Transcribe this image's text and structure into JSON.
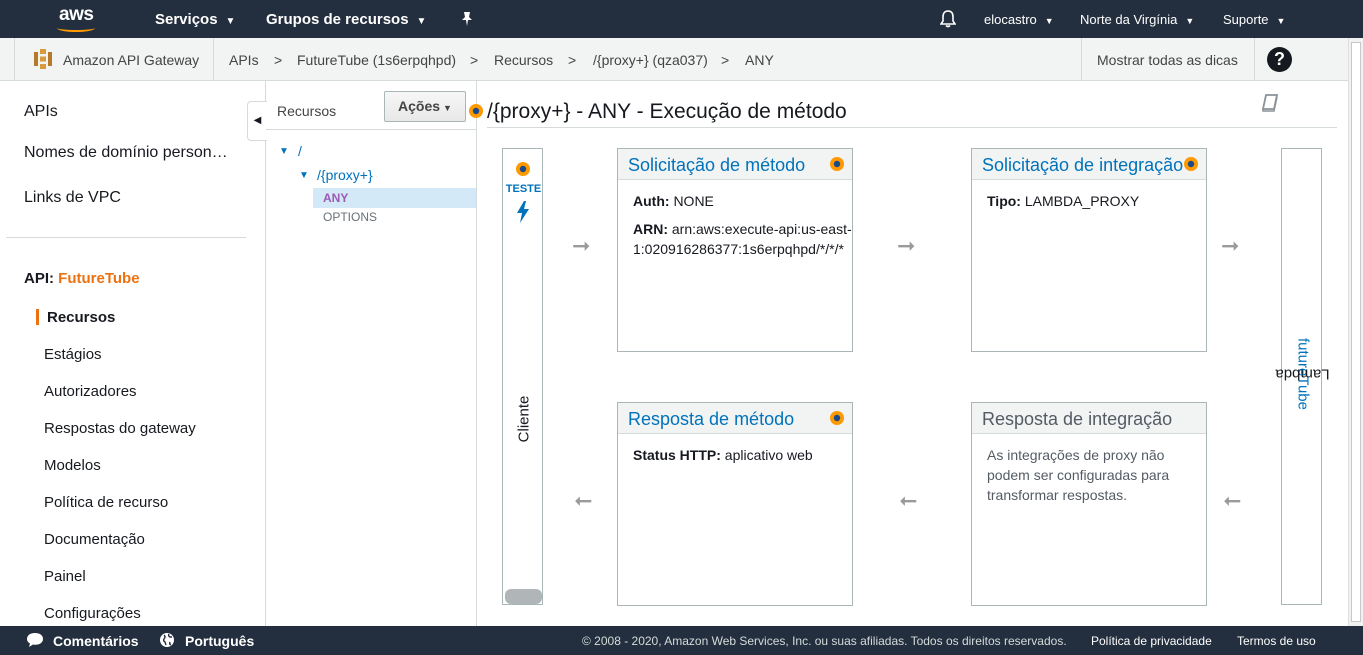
{
  "topnav": {
    "logo": "aws",
    "services": "Serviços",
    "resource_groups": "Grupos de recursos",
    "user": "elocastro",
    "region": "Norte da Virgínia",
    "support": "Suporte",
    "icons": [
      "pin-icon",
      "bell-icon",
      "chevron-down-icon"
    ]
  },
  "breadcrumb": {
    "service": "Amazon API Gateway",
    "items": [
      "APIs",
      "FutureTube (1s6erpqhpd)",
      "Recursos",
      "/{proxy+} (qza037)",
      "ANY"
    ],
    "separator": ">",
    "tips": "Mostrar todas as dicas",
    "help": "?"
  },
  "leftnav": {
    "top_items": [
      "APIs",
      "Nomes de domínio person…",
      "Links de VPC"
    ],
    "api_prefix": "API:",
    "api_name": "FutureTube",
    "sub_items": [
      "Recursos",
      "Estágios",
      "Autorizadores",
      "Respostas do gateway",
      "Modelos",
      "Política de recurso",
      "Documentação",
      "Painel",
      "Configurações"
    ],
    "active": "Recursos"
  },
  "resources": {
    "title": "Recursos",
    "actions": "Ações",
    "root": "/",
    "proxy": "/{proxy+}",
    "any": "ANY",
    "options": "OPTIONS"
  },
  "main": {
    "title": "/{proxy+} - ANY - Execução de método",
    "client_test": "TESTE",
    "client_label": "Cliente",
    "method_request": {
      "title": "Solicitação de método",
      "auth_label": "Auth:",
      "auth_value": "NONE",
      "arn_label": "ARN:",
      "arn_value": "arn:aws:execute-api:us-east-1:020916286377:1s6erpqhpd/*/*/*"
    },
    "integration_request": {
      "title": "Solicitação de integração",
      "type_label": "Tipo:",
      "type_value": "LAMBDA_PROXY"
    },
    "method_response": {
      "title": "Resposta de método",
      "status_label": "Status HTTP:",
      "status_value": "aplicativo web"
    },
    "integration_response": {
      "title": "Resposta de integração",
      "note": "As integrações de proxy não podem ser configuradas para transformar respostas."
    },
    "lambda_prefix": "Lambda",
    "lambda_name": "futureTube"
  },
  "footer": {
    "feedback": "Comentários",
    "language": "Português",
    "copyright": "© 2008 - 2020, Amazon Web Services, Inc. ou suas afiliadas. Todos os direitos reservados.",
    "privacy": "Política de privacidade",
    "terms": "Termos de uso"
  },
  "colors": {
    "nav_bg": "#232f3e",
    "accent_orange": "#ec7211",
    "link_blue": "#0073bb"
  }
}
